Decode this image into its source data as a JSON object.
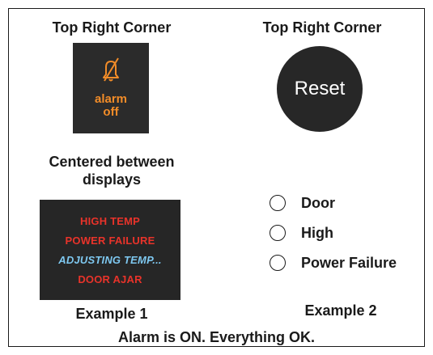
{
  "headings": {
    "alarm_button_position": "Top Right Corner",
    "reset_button_position": "Top Right Corner",
    "display_position_line1": "Centered between",
    "display_position_line2": "displays"
  },
  "alarm_off_button": {
    "icon": "bell-slash-icon",
    "label_line1": "alarm",
    "label_line2": "off",
    "accent_color": "#f28c28"
  },
  "reset_button": {
    "label": "Reset"
  },
  "message_display": {
    "messages": [
      {
        "text": "HIGH TEMP",
        "color": "#e8332a",
        "style": "normal"
      },
      {
        "text": "POWER FAILURE",
        "color": "#e8332a",
        "style": "normal"
      },
      {
        "text": "ADJUSTING TEMP...",
        "color": "#7ec8f0",
        "style": "italic"
      },
      {
        "text": "DOOR AJAR",
        "color": "#e8332a",
        "style": "normal"
      }
    ]
  },
  "indicators": [
    {
      "label": "Door",
      "active": false
    },
    {
      "label": "High",
      "active": false
    },
    {
      "label": "Power Failure",
      "active": false
    }
  ],
  "captions": {
    "example1": "Example 1",
    "example2": "Example 2"
  },
  "status_text": "Alarm is ON. Everything OK."
}
